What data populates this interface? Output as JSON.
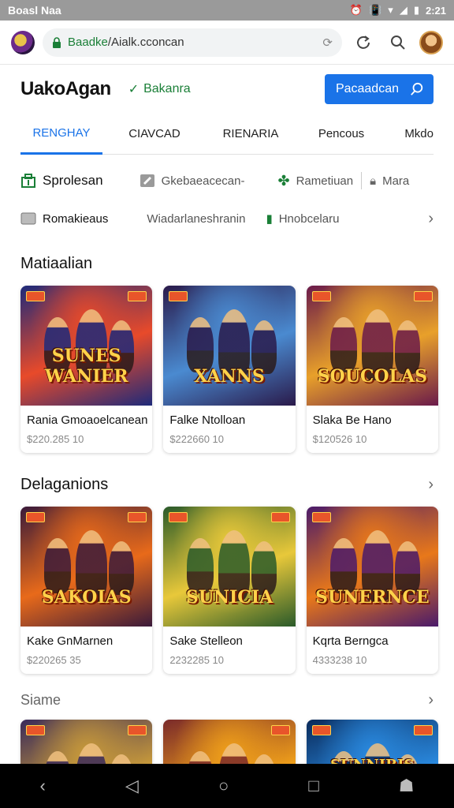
{
  "status_bar": {
    "left_text": "Boasl Naa",
    "time": "2:21"
  },
  "browser": {
    "url_green": "Baadke",
    "url_rest": "/Aialk.cconcan"
  },
  "header": {
    "brand": "UakoAgan",
    "verified_label": "Bakanra",
    "cta_label": "Pacaadcan"
  },
  "tabs": [
    "RENGHAY",
    "CIAVCAD",
    "RIENARIA",
    "Pencous",
    "Mkdo"
  ],
  "filters_row1": {
    "primary": "Sprolesan",
    "second": "Gkebaeacecan-",
    "third": "Rametiuan",
    "fourth": "Mara"
  },
  "filters_row2": {
    "first": "Romakieaus",
    "second": "Wiadarlaneshranin",
    "third": "Hnobcelaru"
  },
  "section1": {
    "title": "Matiaalian",
    "cards": [
      {
        "title": "Rania Gmoaoelcanean",
        "price": "$220.285 10",
        "art_text": "SUNES WANIER",
        "colors": [
          "#1e2a7a",
          "#e84a2a"
        ]
      },
      {
        "title": "Falke Ntolloan",
        "price": "$222660 10",
        "art_text": "XANNS",
        "colors": [
          "#2a1a4a",
          "#4a8ad0"
        ]
      },
      {
        "title": "Slaka Be Hano",
        "price": "$120526 10",
        "art_text": "SOUCOLAS",
        "colors": [
          "#6a1a4a",
          "#e8a02a"
        ]
      }
    ]
  },
  "section2": {
    "title": "Delaganions",
    "cards": [
      {
        "title": "Kake GnMarnen",
        "price": "$220265 35",
        "art_text": "SAKOIAS",
        "colors": [
          "#3a1a3a",
          "#e86a1a"
        ]
      },
      {
        "title": "Sake Stelleon",
        "price": "2232285 10",
        "art_text": "SUNICIA",
        "colors": [
          "#2a5a2a",
          "#e8c83a"
        ]
      },
      {
        "title": "Kqrta Berngca",
        "price": "4333238 10",
        "art_text": "SUNERNCE",
        "colors": [
          "#4a1a6a",
          "#e8781a"
        ]
      }
    ]
  },
  "section3": {
    "title": "Siame",
    "cards": [
      {
        "art_text": "",
        "colors": [
          "#3a2a5a",
          "#c89a3a"
        ]
      },
      {
        "art_text": "",
        "colors": [
          "#7a2a2a",
          "#f0a01a"
        ]
      },
      {
        "art_text": "SUNNIRIS",
        "colors": [
          "#0a2a5a",
          "#2a8ae0"
        ]
      }
    ]
  }
}
